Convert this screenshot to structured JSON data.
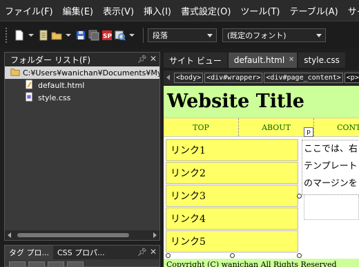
{
  "menu": [
    "ファイル(F)",
    "編集(E)",
    "表示(V)",
    "挿入(I)",
    "書式設定(O)",
    "ツール(T)",
    "テーブル(A)",
    "サイト"
  ],
  "toolbar": {
    "style_select": "段落",
    "font_select": "(既定のフォント)",
    "icons": [
      "new-page-icon",
      "document-icon",
      "open-folder-icon",
      "save-icon",
      "save-all-icon",
      "sharepoint-icon",
      "preview-icon"
    ]
  },
  "folder_panel": {
    "title": "フォルダー リスト(F)",
    "root_path": "C:¥Users¥wanichan¥Documents¥My W",
    "files": [
      "default.html",
      "style.css"
    ]
  },
  "bottom_panel": {
    "tabs": [
      "タグ プロ...",
      "CSS プロパ..."
    ]
  },
  "doc_tabs": [
    {
      "label": "サイト ビュー",
      "active": false
    },
    {
      "label": "default.html",
      "active": true
    },
    {
      "label": "style.css",
      "active": false
    }
  ],
  "breadcrumbs": [
    "<body>",
    "<div#wrapper>",
    "<div#page_content>",
    "<p>"
  ],
  "page": {
    "title": "Website Title",
    "nav": [
      "TOP",
      "ABOUT",
      "CONTA"
    ],
    "links": [
      "リンク1",
      "リンク2",
      "リンク3",
      "リンク4",
      "リンク5"
    ],
    "content_lines": [
      "ここでは、右",
      "テンプレート",
      "のマージンを"
    ],
    "p_marker": "p",
    "footer": "Copyright (C) wanichan All Rights Reserved"
  },
  "colors": {
    "header_bg": "#ccff99",
    "nav_bg": "#ffff66",
    "nav_text": "#006600",
    "panel_bg": "#3a3a3a"
  }
}
